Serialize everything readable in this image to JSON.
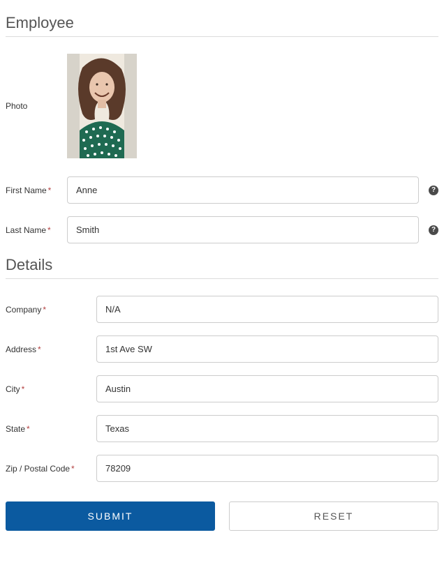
{
  "sections": {
    "employee": {
      "title": "Employee"
    },
    "details": {
      "title": "Details"
    }
  },
  "employee": {
    "photo_label": "Photo",
    "first_name": {
      "label": "First Name",
      "value": "Anne"
    },
    "last_name": {
      "label": "Last Name",
      "value": "Smith"
    }
  },
  "details": {
    "company": {
      "label": "Company",
      "value": "N/A"
    },
    "address": {
      "label": "Address",
      "value": "1st Ave SW"
    },
    "city": {
      "label": "City",
      "value": "Austin"
    },
    "state": {
      "label": "State",
      "value": "Texas"
    },
    "zip": {
      "label": "Zip / Postal Code",
      "value": "78209"
    }
  },
  "buttons": {
    "submit": "SUBMIT",
    "reset": "RESET"
  },
  "required_marker": "*",
  "help_marker": "?"
}
